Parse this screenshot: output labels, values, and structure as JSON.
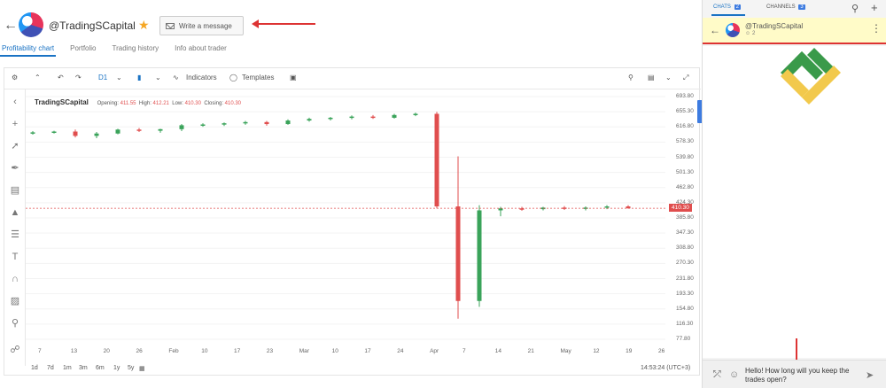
{
  "header": {
    "username": "@TradingSCapital",
    "write_message": "Write a message",
    "tabs": [
      "Profitability chart",
      "Portfolio",
      "Trading history",
      "Info about trader"
    ]
  },
  "toolbar": {
    "timeframe": "D1",
    "indicators": "Indicators",
    "templates": "Templates"
  },
  "chart_legend": {
    "symbol": "TradingSCapital",
    "opening_label": "Opening:",
    "opening": "411.55",
    "high_label": "High:",
    "high": "412.21",
    "low_label": "Low:",
    "low": "410.30",
    "closing_label": "Closing:",
    "closing": "410.30"
  },
  "chart_data": {
    "type": "candlestick",
    "price_ticks": [
      "693.80",
      "655.30",
      "616.80",
      "578.30",
      "539.80",
      "501.30",
      "462.80",
      "424.30",
      "385.80",
      "347.30",
      "308.80",
      "270.30",
      "231.80",
      "193.30",
      "154.80",
      "116.30",
      "77.80"
    ],
    "time_ticks": [
      "7",
      "13",
      "20",
      "26",
      "Feb",
      "10",
      "17",
      "23",
      "Mar",
      "10",
      "17",
      "24",
      "Apr",
      "7",
      "14",
      "21",
      "May",
      "12",
      "19",
      "26"
    ],
    "last_price": "410.30",
    "ylim": [
      77.8,
      693.8
    ],
    "series": [
      {
        "x": 0,
        "o": 601,
        "h": 606,
        "l": 597,
        "c": 603
      },
      {
        "x": 1,
        "o": 603,
        "h": 607,
        "l": 600,
        "c": 605
      },
      {
        "x": 2,
        "o": 605,
        "h": 610,
        "l": 590,
        "c": 594
      },
      {
        "x": 3,
        "o": 594,
        "h": 604,
        "l": 588,
        "c": 600
      },
      {
        "x": 4,
        "o": 600,
        "h": 612,
        "l": 598,
        "c": 610
      },
      {
        "x": 5,
        "o": 610,
        "h": 614,
        "l": 604,
        "c": 607
      },
      {
        "x": 6,
        "o": 607,
        "h": 612,
        "l": 602,
        "c": 611
      },
      {
        "x": 7,
        "o": 611,
        "h": 624,
        "l": 606,
        "c": 621
      },
      {
        "x": 8,
        "o": 621,
        "h": 626,
        "l": 617,
        "c": 623
      },
      {
        "x": 9,
        "o": 623,
        "h": 628,
        "l": 619,
        "c": 626
      },
      {
        "x": 10,
        "o": 626,
        "h": 632,
        "l": 622,
        "c": 629
      },
      {
        "x": 11,
        "o": 629,
        "h": 632,
        "l": 620,
        "c": 624
      },
      {
        "x": 12,
        "o": 624,
        "h": 636,
        "l": 622,
        "c": 633
      },
      {
        "x": 13,
        "o": 633,
        "h": 640,
        "l": 630,
        "c": 637
      },
      {
        "x": 14,
        "o": 637,
        "h": 642,
        "l": 633,
        "c": 640
      },
      {
        "x": 15,
        "o": 640,
        "h": 646,
        "l": 636,
        "c": 643
      },
      {
        "x": 16,
        "o": 643,
        "h": 647,
        "l": 637,
        "c": 640
      },
      {
        "x": 17,
        "o": 640,
        "h": 650,
        "l": 638,
        "c": 647
      },
      {
        "x": 18,
        "o": 647,
        "h": 653,
        "l": 644,
        "c": 650
      },
      {
        "x": 19,
        "o": 650,
        "h": 655,
        "l": 410,
        "c": 415
      },
      {
        "x": 20,
        "o": 415,
        "h": 542,
        "l": 130,
        "c": 175
      },
      {
        "x": 21,
        "o": 175,
        "h": 418,
        "l": 160,
        "c": 405
      },
      {
        "x": 22,
        "o": 405,
        "h": 414,
        "l": 390,
        "c": 410
      },
      {
        "x": 23,
        "o": 410,
        "h": 414,
        "l": 404,
        "c": 408
      },
      {
        "x": 24,
        "o": 408,
        "h": 414,
        "l": 405,
        "c": 412
      },
      {
        "x": 25,
        "o": 412,
        "h": 416,
        "l": 406,
        "c": 410
      },
      {
        "x": 26,
        "o": 410,
        "h": 415,
        "l": 405,
        "c": 412
      },
      {
        "x": 27,
        "o": 412,
        "h": 418,
        "l": 408,
        "c": 415
      },
      {
        "x": 28,
        "o": 415,
        "h": 418,
        "l": 410,
        "c": 410
      }
    ]
  },
  "bottom_bar": {
    "ranges": [
      "1d",
      "7d",
      "1m",
      "3m",
      "6m",
      "1y",
      "5y"
    ],
    "time": "14:53:24 (UTC+3)"
  },
  "right_panel": {
    "chats_label": "CHATS",
    "chats_count": "2",
    "channels_label": "CHANNELS",
    "channels_count": "3",
    "chat_name": "@TradingSCapital",
    "members": "2",
    "message": "Hello! How long will you keep the trades open?"
  }
}
